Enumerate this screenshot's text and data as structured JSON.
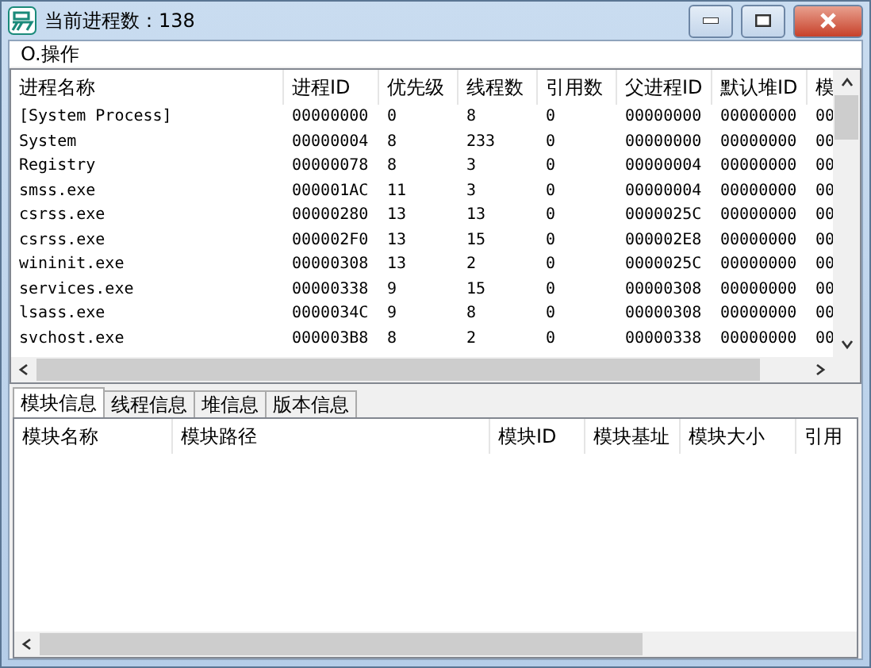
{
  "window": {
    "title": "当前进程数：138"
  },
  "menu": [
    {
      "label": "O.操作"
    }
  ],
  "process_table": {
    "columns": [
      "进程名称",
      "进程ID",
      "优先级",
      "线程数",
      "引用数",
      "父进程ID",
      "默认堆ID",
      "模"
    ],
    "rows": [
      [
        "[System Process]",
        "00000000",
        "0",
        "8",
        "0",
        "00000000",
        "00000000",
        "00"
      ],
      [
        "System",
        "00000004",
        "8",
        "233",
        "0",
        "00000000",
        "00000000",
        "00"
      ],
      [
        "Registry",
        "00000078",
        "8",
        "3",
        "0",
        "00000004",
        "00000000",
        "00"
      ],
      [
        "smss.exe",
        "000001AC",
        "11",
        "3",
        "0",
        "00000004",
        "00000000",
        "00"
      ],
      [
        "csrss.exe",
        "00000280",
        "13",
        "13",
        "0",
        "0000025C",
        "00000000",
        "00"
      ],
      [
        "csrss.exe",
        "000002F0",
        "13",
        "15",
        "0",
        "000002E8",
        "00000000",
        "00"
      ],
      [
        "wininit.exe",
        "00000308",
        "13",
        "2",
        "0",
        "0000025C",
        "00000000",
        "00"
      ],
      [
        "services.exe",
        "00000338",
        "9",
        "15",
        "0",
        "00000308",
        "00000000",
        "00"
      ],
      [
        "lsass.exe",
        "0000034C",
        "9",
        "8",
        "0",
        "00000308",
        "00000000",
        "00"
      ],
      [
        "svchost.exe",
        "000003B8",
        "8",
        "2",
        "0",
        "00000338",
        "00000000",
        "00"
      ]
    ]
  },
  "tabs": [
    {
      "label": "模块信息",
      "selected": true
    },
    {
      "label": "线程信息",
      "selected": false
    },
    {
      "label": "堆信息",
      "selected": false
    },
    {
      "label": "版本信息",
      "selected": false
    }
  ],
  "module_table": {
    "columns": [
      "模块名称",
      "模块路径",
      "模块ID",
      "模块基址",
      "模块大小",
      "引用"
    ]
  }
}
